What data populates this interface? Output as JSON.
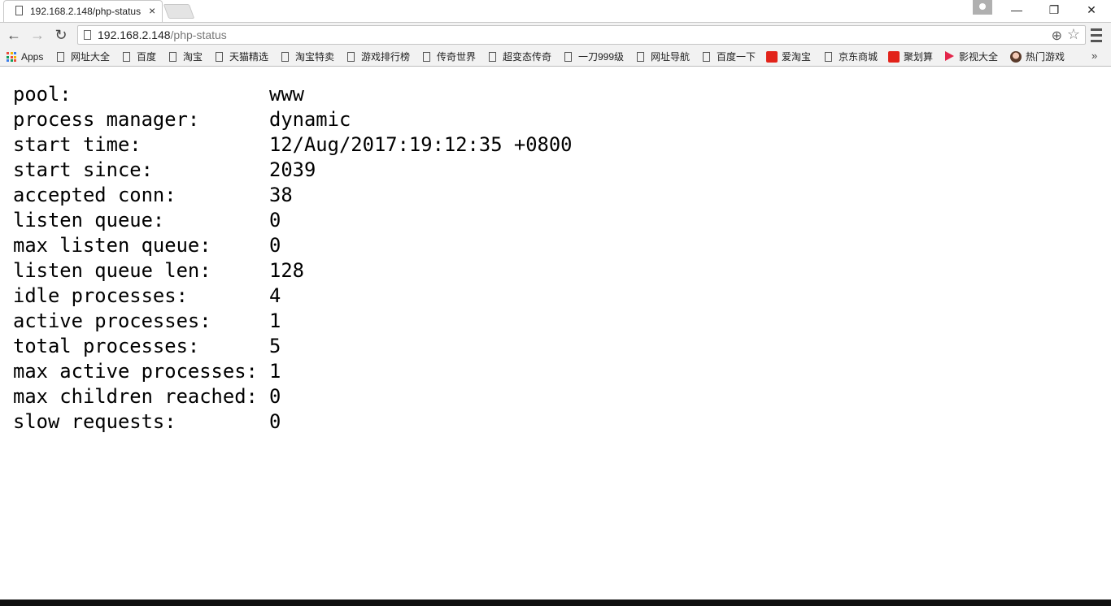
{
  "browser": {
    "tab_title": "192.168.2.148/php-status",
    "tab_close": "×",
    "url_host": "192.168.2.148",
    "url_path": "/php-status",
    "nav": {
      "back": "←",
      "forward": "→",
      "reload": "↻"
    },
    "window_controls": {
      "minimize": "—",
      "restore": "❐",
      "close": "✕"
    },
    "zoom_glyph": "⊕",
    "star_glyph": "☆",
    "more_bookmarks": "»"
  },
  "bookmarks": [
    {
      "label": "Apps",
      "icon": "apps-grid-icon"
    },
    {
      "label": "网址大全",
      "icon": "page-icon"
    },
    {
      "label": "百度",
      "icon": "page-icon"
    },
    {
      "label": "淘宝",
      "icon": "page-icon"
    },
    {
      "label": "天猫精选",
      "icon": "page-icon"
    },
    {
      "label": "淘宝特卖",
      "icon": "page-icon"
    },
    {
      "label": "游戏排行榜",
      "icon": "page-icon"
    },
    {
      "label": "传奇世界",
      "icon": "page-icon"
    },
    {
      "label": "超变态传奇",
      "icon": "page-icon"
    },
    {
      "label": "一刀999级",
      "icon": "page-icon"
    },
    {
      "label": "网址导航",
      "icon": "page-icon"
    },
    {
      "label": "百度一下",
      "icon": "page-icon"
    },
    {
      "label": "爱淘宝",
      "icon": "taobao-icon"
    },
    {
      "label": "京东商城",
      "icon": "page-icon"
    },
    {
      "label": "聚划算",
      "icon": "juhuasuan-icon"
    },
    {
      "label": "影视大全",
      "icon": "play-icon"
    },
    {
      "label": "热门游戏",
      "icon": "avatar-icon"
    }
  ],
  "status": [
    {
      "key": "pool:",
      "value": "www"
    },
    {
      "key": "process manager:",
      "value": "dynamic"
    },
    {
      "key": "start time:",
      "value": "12/Aug/2017:19:12:35 +0800"
    },
    {
      "key": "start since:",
      "value": "2039"
    },
    {
      "key": "accepted conn:",
      "value": "38"
    },
    {
      "key": "listen queue:",
      "value": "0"
    },
    {
      "key": "max listen queue:",
      "value": "0"
    },
    {
      "key": "listen queue len:",
      "value": "128"
    },
    {
      "key": "idle processes:",
      "value": "4"
    },
    {
      "key": "active processes:",
      "value": "1"
    },
    {
      "key": "total processes:",
      "value": "5"
    },
    {
      "key": "max active processes:",
      "value": "1"
    },
    {
      "key": "max children reached:",
      "value": "0"
    },
    {
      "key": "slow requests:",
      "value": "0"
    }
  ]
}
